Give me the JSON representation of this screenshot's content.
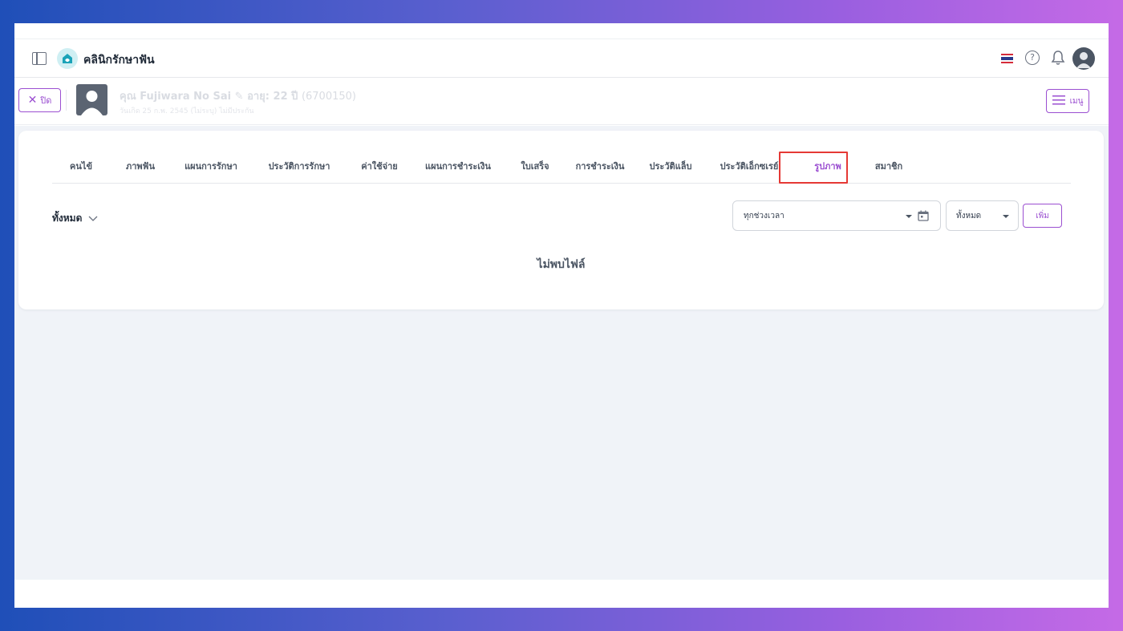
{
  "header": {
    "clinic_name": "คลินิกรักษาฟัน"
  },
  "patient": {
    "close_label": "ปิด",
    "name": "คุณ Fujiwara No Sai",
    "age": "อายุ: 22 ปี",
    "id": "(6700150)",
    "subline": "วันเกิด 25 ก.พ. 2545 (ไม่ระบุ) ไม่มีประกัน",
    "menu_label": "เมนู"
  },
  "tabs": [
    {
      "label": "คนไข้"
    },
    {
      "label": "ภาพฟัน"
    },
    {
      "label": "แผนการรักษา"
    },
    {
      "label": "ประวัติการรักษา"
    },
    {
      "label": "ค่าใช้จ่าย"
    },
    {
      "label": "แผนการชำระเงิน"
    },
    {
      "label": "ใบเสร็จ"
    },
    {
      "label": "การชำระเงิน"
    },
    {
      "label": "ประวัติแล็บ"
    },
    {
      "label": "ประวัติเอ็กซเรย์"
    },
    {
      "label": "รูปภาพ",
      "active": true
    },
    {
      "label": "สมาชิก"
    }
  ],
  "filters": {
    "category_label": "ทั้งหมด",
    "date_range": "ทุกช่วงเวลา",
    "type_select": "ทั้งหมด",
    "add_label": "เพิ่ม"
  },
  "empty_message": "ไม่พบไฟล์",
  "colors": {
    "accent": "#9b4fd1",
    "highlight": "#e53935",
    "page_bg": "#f0f3f8"
  }
}
